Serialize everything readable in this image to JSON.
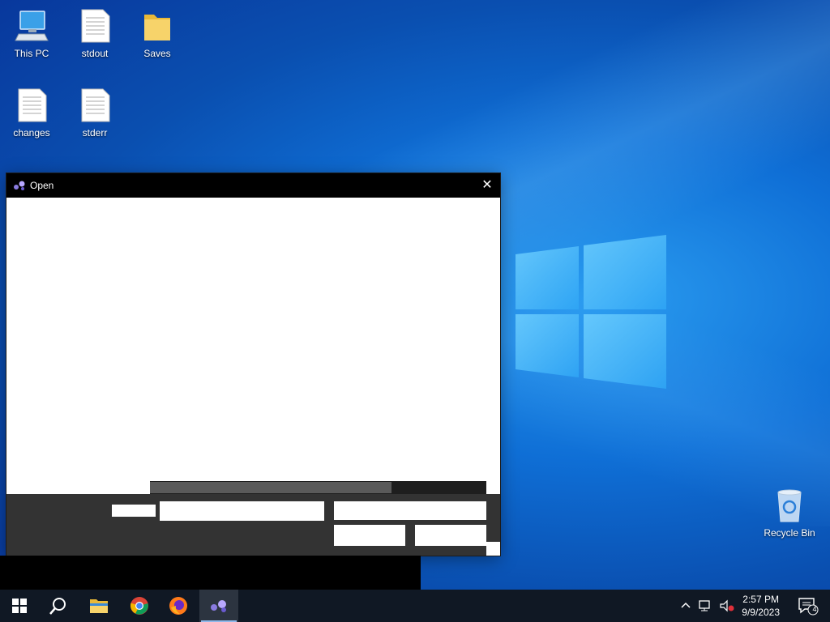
{
  "desktop": {
    "icons": [
      {
        "label": "This PC",
        "icon": "computer-icon"
      },
      {
        "label": "stdout",
        "icon": "text-file-icon"
      },
      {
        "label": "Saves",
        "icon": "folder-icon"
      },
      {
        "label": "changes",
        "icon": "text-file-icon"
      },
      {
        "label": "stderr",
        "icon": "text-file-icon"
      },
      {
        "label": "Recycle Bin",
        "icon": "recycle-bin-icon"
      }
    ]
  },
  "dialog": {
    "title": "Open",
    "close_glyph": "✕",
    "file_name_label": "",
    "file_name_value": "",
    "file_type_value": "",
    "open_button_label": "",
    "cancel_button_label": ""
  },
  "taskbar": {
    "items": [
      {
        "name": "start",
        "icon": "windows-start-icon"
      },
      {
        "name": "search",
        "icon": "search-icon"
      },
      {
        "name": "file-explorer",
        "icon": "folder-icon"
      },
      {
        "name": "chrome",
        "icon": "chrome-icon"
      },
      {
        "name": "firefox",
        "icon": "firefox-icon"
      },
      {
        "name": "app",
        "icon": "app-icon",
        "active": true
      }
    ],
    "clock_time": "2:57 PM",
    "clock_date": "9/9/2023",
    "notification_count": "4"
  },
  "colors": {
    "accent": "#0f6fd6",
    "dialog_footer": "#333333",
    "titlebar": "#000000"
  }
}
